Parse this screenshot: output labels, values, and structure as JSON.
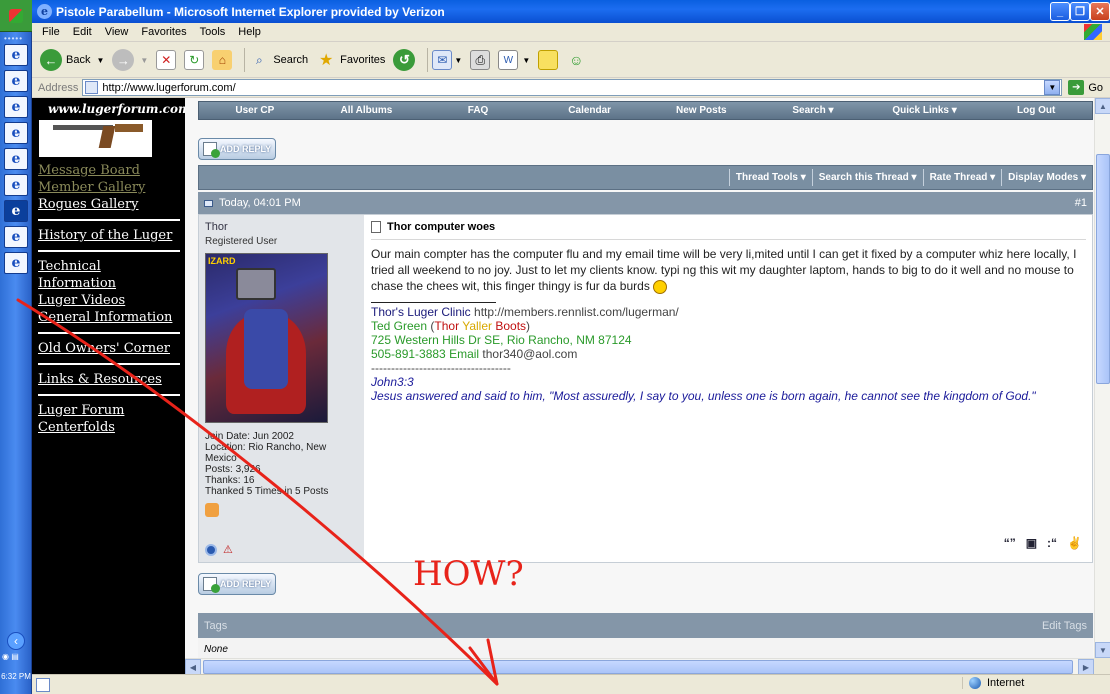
{
  "window": {
    "title": "Pistole Parabellum - Microsoft Internet Explorer provided by Verizon"
  },
  "taskbar": {
    "clock": "6:32 PM"
  },
  "menu": [
    "File",
    "Edit",
    "View",
    "Favorites",
    "Tools",
    "Help"
  ],
  "toolbar": {
    "back_label": "Back",
    "search_label": "Search",
    "favorites_label": "Favorites"
  },
  "address": {
    "label": "Address",
    "url": "http://www.lugerforum.com/",
    "go_label": "Go"
  },
  "site_nav": {
    "site_name": "www.lugerforum.com",
    "groups": [
      [
        "Message Board",
        "Member Gallery",
        "Rogues Gallery"
      ],
      [
        "History of the Luger"
      ],
      [
        "Technical Information",
        "Luger Videos",
        "General Information"
      ],
      [
        "Old Owners' Corner"
      ],
      [
        "Links & Resources"
      ],
      [
        "Luger Forum",
        "Centerfolds"
      ]
    ]
  },
  "forum_nav": [
    "User CP",
    "All Albums",
    "FAQ",
    "Calendar",
    "New Posts",
    "Search ▾",
    "Quick Links ▾",
    "Log Out"
  ],
  "add_reply_label": "ADD REPLY",
  "thread_tools": [
    "Thread Tools ▾",
    "Search this Thread ▾",
    "Rate Thread ▾",
    "Display Modes ▾"
  ],
  "post": {
    "date": "Today, 04:01 PM",
    "number": "#1",
    "user": {
      "name": "Thor",
      "title": "Registered User",
      "avatar_text": "IZARD",
      "join_date": "Join Date: Jun 2002",
      "location": "Location: Rio Rancho, New Mexico",
      "posts": "Posts: 3,926",
      "thanks": "Thanks: 16",
      "thanked": "Thanked 5 Times in 5 Posts"
    },
    "title": "Thor computer woes",
    "message": "Our main compter has the computer flu and my email time will be very li,mited until I can get it fixed by a computer whiz here locally, I tried all weekend to no joy. Just to let my clients know. typi ng this wit my daughter laptom, hands to big to do it well and no mouse to chase the chees wit, this finger thingy is fur da burds",
    "signature": {
      "clinic": "Thor's Luger Clinic",
      "clinic_url": "http://members.rennlist.com/lugerman/",
      "name": "Ted Green",
      "paren_open": "(",
      "nick1": "Thor",
      "nick2": "Yaller",
      "nick3": "Boots",
      "paren_close": ")",
      "street": "725 Western Hills Dr SE, Rio Rancho, NM 87124",
      "phone": "505-891-3883 Email",
      "email": "thor340@aol.com",
      "dashes": "-----------------------------------",
      "verse_ref": "John3:3",
      "verse": "Jesus answered and said to him, \"Most assuredly, I say to you, unless one is born again, he cannot see the kingdom of God.\""
    }
  },
  "tags": {
    "title": "Tags",
    "edit": "Edit Tags",
    "value": "None"
  },
  "annotation": {
    "text": "HOW?",
    "color": "#e8231a"
  },
  "status": {
    "zone": "Internet"
  }
}
